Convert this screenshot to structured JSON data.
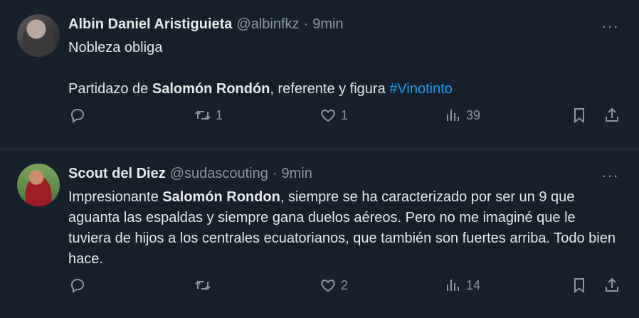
{
  "tweets": [
    {
      "name": "Albin Daniel Aristiguieta",
      "handle": "@albinfkz",
      "dot": "·",
      "time": "9min",
      "more": "···",
      "para1": "Nobleza obliga",
      "para2_a": "Partidazo de ",
      "para2_bold": "Salomón Rondón",
      "para2_b": ", referente y figura ",
      "hashtag": "#Vinotinto",
      "replies": "",
      "retweets": "1",
      "likes": "1",
      "views": "39"
    },
    {
      "name": "Scout del Diez",
      "handle": "@sudascouting",
      "dot": "·",
      "time": "9min",
      "more": "···",
      "text_a": "Impresionante ",
      "text_bold": "Salomón Rondon",
      "text_b": ", siempre se ha caracterizado por ser un 9 que aguanta las espaldas y siempre gana duelos aéreos. Pero no me imaginé que le tuviera de hijos a los centrales ecuatorianos, que también son fuertes arriba. Todo bien hace.",
      "replies": "",
      "retweets": "",
      "likes": "2",
      "views": "14"
    }
  ],
  "icons": {
    "reply": "reply-icon",
    "retweet": "retweet-icon",
    "like": "heart-icon",
    "views": "views-icon",
    "bookmark": "bookmark-icon",
    "share": "share-icon"
  },
  "colors": {
    "background": "#15202b",
    "primary_text": "#e7e9ea",
    "secondary_text": "#8b98a5",
    "link": "#1d9bf0",
    "divider": "#38444d"
  }
}
